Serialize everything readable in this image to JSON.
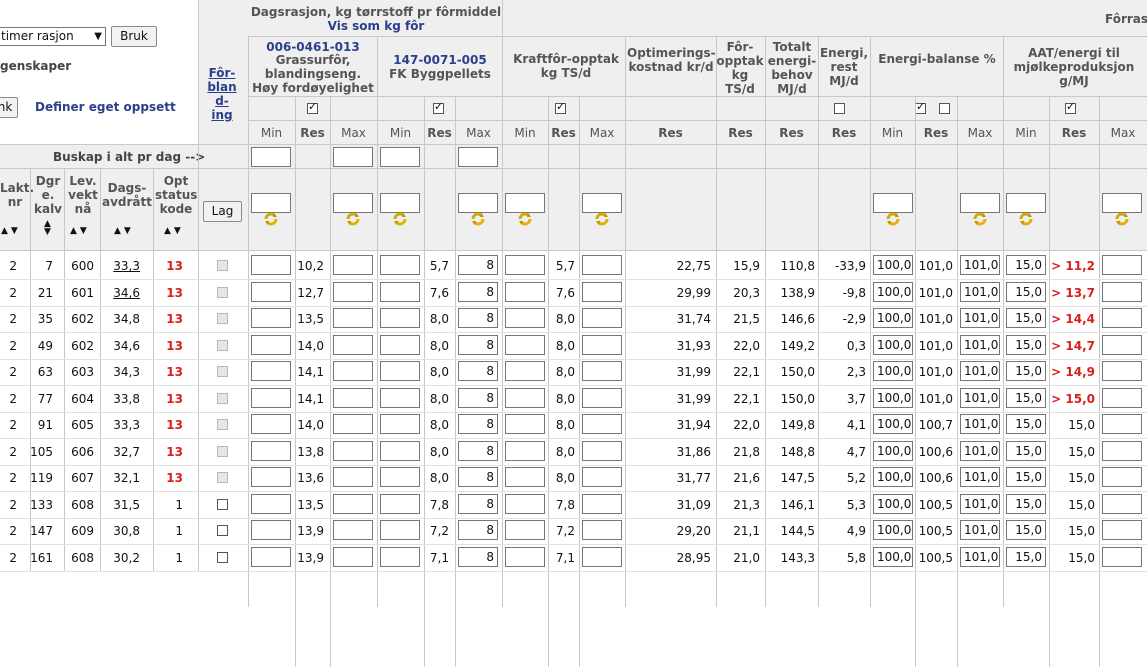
{
  "left_panel": {
    "ration_select_value": "timer rasjon",
    "apply_button": "Bruk",
    "properties_label": "genskaper",
    "partial_button": "nk",
    "define_layout_link": "Definer eget oppsett",
    "herd_total_label": "Buskap i alt pr dag -->"
  },
  "columns_left": {
    "lakt": "Lakt. nr",
    "dgr": "Dgr e. kalv",
    "lev": "Lev. vekt nå",
    "dags": "Dags-avdrått",
    "opt": "Opt status kode"
  },
  "forblanding": {
    "label": "Fôr-bland-ing",
    "button": "Lag"
  },
  "group_header": {
    "title": "Dagsrasjon, kg tørrstoff pr fôrmiddel",
    "link": "Vis som kg fôr",
    "right": "Fôrras"
  },
  "feeds": [
    {
      "code": "006-0461-013",
      "name": "Grassurfôr, blandingseng. Høy fordøyelighet"
    },
    {
      "code": "147-0071-005",
      "name": "FK Byggpellets"
    }
  ],
  "metric_headers": {
    "kraftfor": "Kraftfôr-opptak kg TS/d",
    "opt_kost": "Optimerings-kostnad kr/d",
    "for_opptak": "Fôr-opptak kg TS/d",
    "total_energi": "Totalt energi-behov MJ/d",
    "energi_rest": "Energi, rest MJ/d",
    "energi_balanse": "Energi-balanse %",
    "aat": "AAT/energi til mjølkeproduksjon g/MJ"
  },
  "subheaders": {
    "min": "Min",
    "res": "Res",
    "max": "Max"
  },
  "icons": {
    "recycle": "recycle-icon",
    "sort": "sort-arrows-icon"
  },
  "rows": [
    {
      "lakt": "2",
      "dgr": "7",
      "lev": "600",
      "dags": "33,3",
      "dags_link": true,
      "opt": "13",
      "optred": true,
      "fb": "dis",
      "f1": "10,2",
      "f2": "5,7",
      "f2max": "8",
      "kf": "5,7",
      "kost": "22,75",
      "fo": "15,9",
      "te": "110,8",
      "er": "-33,9",
      "ebmin": "100,0",
      "eb": "101,0",
      "ebmax": "101,0",
      "aatmin": "15,0",
      "aat": "> 11,2",
      "aatred": true
    },
    {
      "lakt": "2",
      "dgr": "21",
      "lev": "601",
      "dags": "34,6",
      "dags_link": true,
      "opt": "13",
      "optred": true,
      "fb": "dis",
      "f1": "12,7",
      "f2": "7,6",
      "f2max": "8",
      "kf": "7,6",
      "kost": "29,99",
      "fo": "20,3",
      "te": "138,9",
      "er": "-9,8",
      "ebmin": "100,0",
      "eb": "101,0",
      "ebmax": "101,0",
      "aatmin": "15,0",
      "aat": "> 13,7",
      "aatred": true
    },
    {
      "lakt": "2",
      "dgr": "35",
      "lev": "602",
      "dags": "34,8",
      "dags_link": false,
      "opt": "13",
      "optred": true,
      "fb": "dis",
      "f1": "13,5",
      "f2": "8,0",
      "f2max": "8",
      "kf": "8,0",
      "kost": "31,74",
      "fo": "21,5",
      "te": "146,6",
      "er": "-2,9",
      "ebmin": "100,0",
      "eb": "101,0",
      "ebmax": "101,0",
      "aatmin": "15,0",
      "aat": "> 14,4",
      "aatred": true
    },
    {
      "lakt": "2",
      "dgr": "49",
      "lev": "602",
      "dags": "34,6",
      "dags_link": false,
      "opt": "13",
      "optred": true,
      "fb": "dis",
      "f1": "14,0",
      "f2": "8,0",
      "f2max": "8",
      "kf": "8,0",
      "kost": "31,93",
      "fo": "22,0",
      "te": "149,2",
      "er": "0,3",
      "ebmin": "100,0",
      "eb": "101,0",
      "ebmax": "101,0",
      "aatmin": "15,0",
      "aat": "> 14,7",
      "aatred": true
    },
    {
      "lakt": "2",
      "dgr": "63",
      "lev": "603",
      "dags": "34,3",
      "dags_link": false,
      "opt": "13",
      "optred": true,
      "fb": "dis",
      "f1": "14,1",
      "f2": "8,0",
      "f2max": "8",
      "kf": "8,0",
      "kost": "31,99",
      "fo": "22,1",
      "te": "150,0",
      "er": "2,3",
      "ebmin": "100,0",
      "eb": "101,0",
      "ebmax": "101,0",
      "aatmin": "15,0",
      "aat": "> 14,9",
      "aatred": true
    },
    {
      "lakt": "2",
      "dgr": "77",
      "lev": "604",
      "dags": "33,8",
      "dags_link": false,
      "opt": "13",
      "optred": true,
      "fb": "dis",
      "f1": "14,1",
      "f2": "8,0",
      "f2max": "8",
      "kf": "8,0",
      "kost": "31,99",
      "fo": "22,1",
      "te": "150,0",
      "er": "3,7",
      "ebmin": "100,0",
      "eb": "101,0",
      "ebmax": "101,0",
      "aatmin": "15,0",
      "aat": "> 15,0",
      "aatred": true
    },
    {
      "lakt": "2",
      "dgr": "91",
      "lev": "605",
      "dags": "33,3",
      "dags_link": false,
      "opt": "13",
      "optred": true,
      "fb": "dis",
      "f1": "14,0",
      "f2": "8,0",
      "f2max": "8",
      "kf": "8,0",
      "kost": "31,94",
      "fo": "22,0",
      "te": "149,8",
      "er": "4,1",
      "ebmin": "100,0",
      "eb": "100,7",
      "ebmax": "101,0",
      "aatmin": "15,0",
      "aat": "15,0",
      "aatred": false
    },
    {
      "lakt": "2",
      "dgr": "105",
      "lev": "606",
      "dags": "32,7",
      "dags_link": false,
      "opt": "13",
      "optred": true,
      "fb": "dis",
      "f1": "13,8",
      "f2": "8,0",
      "f2max": "8",
      "kf": "8,0",
      "kost": "31,86",
      "fo": "21,8",
      "te": "148,8",
      "er": "4,7",
      "ebmin": "100,0",
      "eb": "100,6",
      "ebmax": "101,0",
      "aatmin": "15,0",
      "aat": "15,0",
      "aatred": false
    },
    {
      "lakt": "2",
      "dgr": "119",
      "lev": "607",
      "dags": "32,1",
      "dags_link": false,
      "opt": "13",
      "optred": true,
      "fb": "dis",
      "f1": "13,6",
      "f2": "8,0",
      "f2max": "8",
      "kf": "8,0",
      "kost": "31,77",
      "fo": "21,6",
      "te": "147,5",
      "er": "5,2",
      "ebmin": "100,0",
      "eb": "100,6",
      "ebmax": "101,0",
      "aatmin": "15,0",
      "aat": "15,0",
      "aatred": false
    },
    {
      "lakt": "2",
      "dgr": "133",
      "lev": "608",
      "dags": "31,5",
      "dags_link": false,
      "opt": "1",
      "optred": false,
      "fb": "on",
      "f1": "13,5",
      "f2": "7,8",
      "f2max": "8",
      "kf": "7,8",
      "kost": "31,09",
      "fo": "21,3",
      "te": "146,1",
      "er": "5,3",
      "ebmin": "100,0",
      "eb": "100,5",
      "ebmax": "101,0",
      "aatmin": "15,0",
      "aat": "15,0",
      "aatred": false
    },
    {
      "lakt": "2",
      "dgr": "147",
      "lev": "609",
      "dags": "30,8",
      "dags_link": false,
      "opt": "1",
      "optred": false,
      "fb": "on",
      "f1": "13,9",
      "f2": "7,2",
      "f2max": "8",
      "kf": "7,2",
      "kost": "29,20",
      "fo": "21,1",
      "te": "144,5",
      "er": "4,9",
      "ebmin": "100,0",
      "eb": "100,5",
      "ebmax": "101,0",
      "aatmin": "15,0",
      "aat": "15,0",
      "aatred": false
    },
    {
      "lakt": "2",
      "dgr": "161",
      "lev": "608",
      "dags": "30,2",
      "dags_link": false,
      "opt": "1",
      "optred": false,
      "fb": "on",
      "f1": "13,9",
      "f2": "7,1",
      "f2max": "8",
      "kf": "7,1",
      "kost": "28,95",
      "fo": "21,0",
      "te": "143,3",
      "er": "5,8",
      "ebmin": "100,0",
      "eb": "100,5",
      "ebmax": "101,0",
      "aatmin": "15,0",
      "aat": "15,0",
      "aatred": false
    }
  ]
}
